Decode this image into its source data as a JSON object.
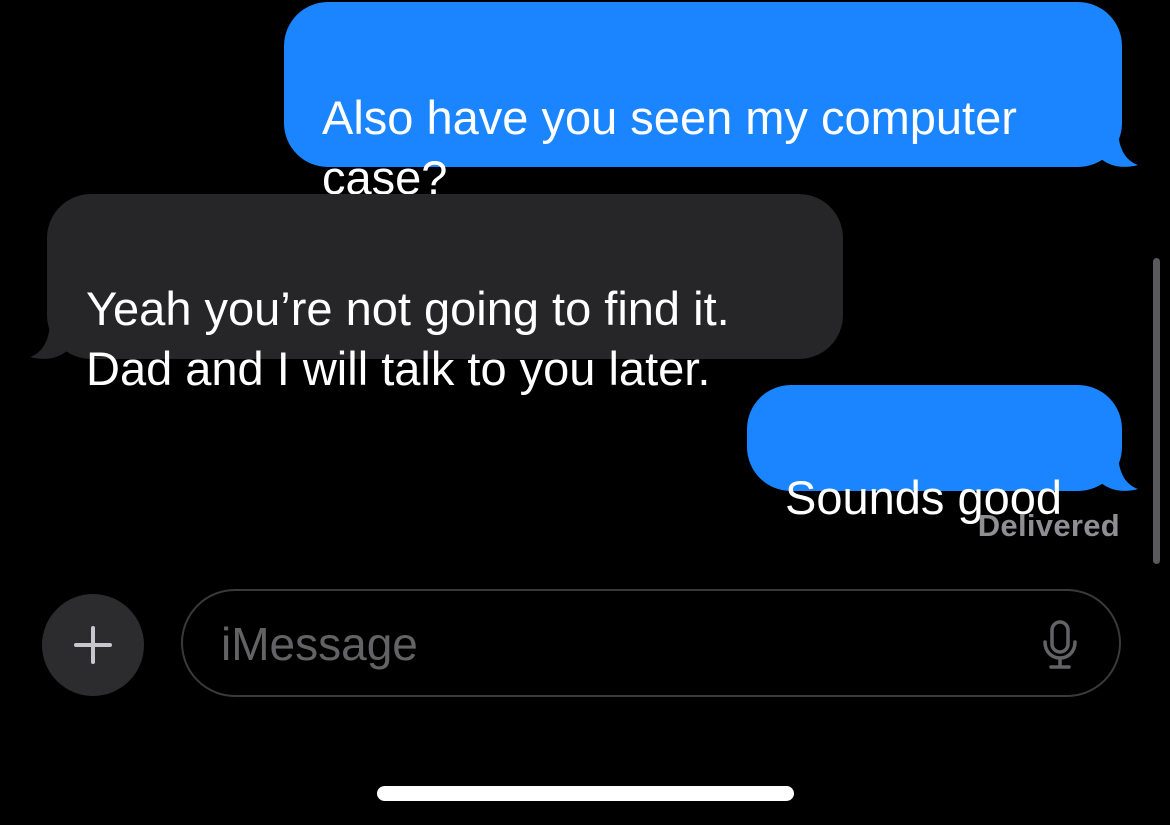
{
  "conversation": {
    "messages": [
      {
        "direction": "sent",
        "text": "Also have you seen my computer\ncase?"
      },
      {
        "direction": "received",
        "text": "Yeah you’re not going to find it.\nDad and I will talk to you later."
      },
      {
        "direction": "sent",
        "text": "Sounds good"
      }
    ],
    "status": "Delivered"
  },
  "composer": {
    "add_icon": "plus-icon",
    "placeholder": "iMessage",
    "value": "",
    "mic_icon": "microphone-icon"
  },
  "colors": {
    "background": "#000000",
    "sent_bubble": "#1a85ff",
    "received_bubble": "#262628",
    "status_text": "#8e8e93",
    "placeholder_text": "#636366"
  }
}
